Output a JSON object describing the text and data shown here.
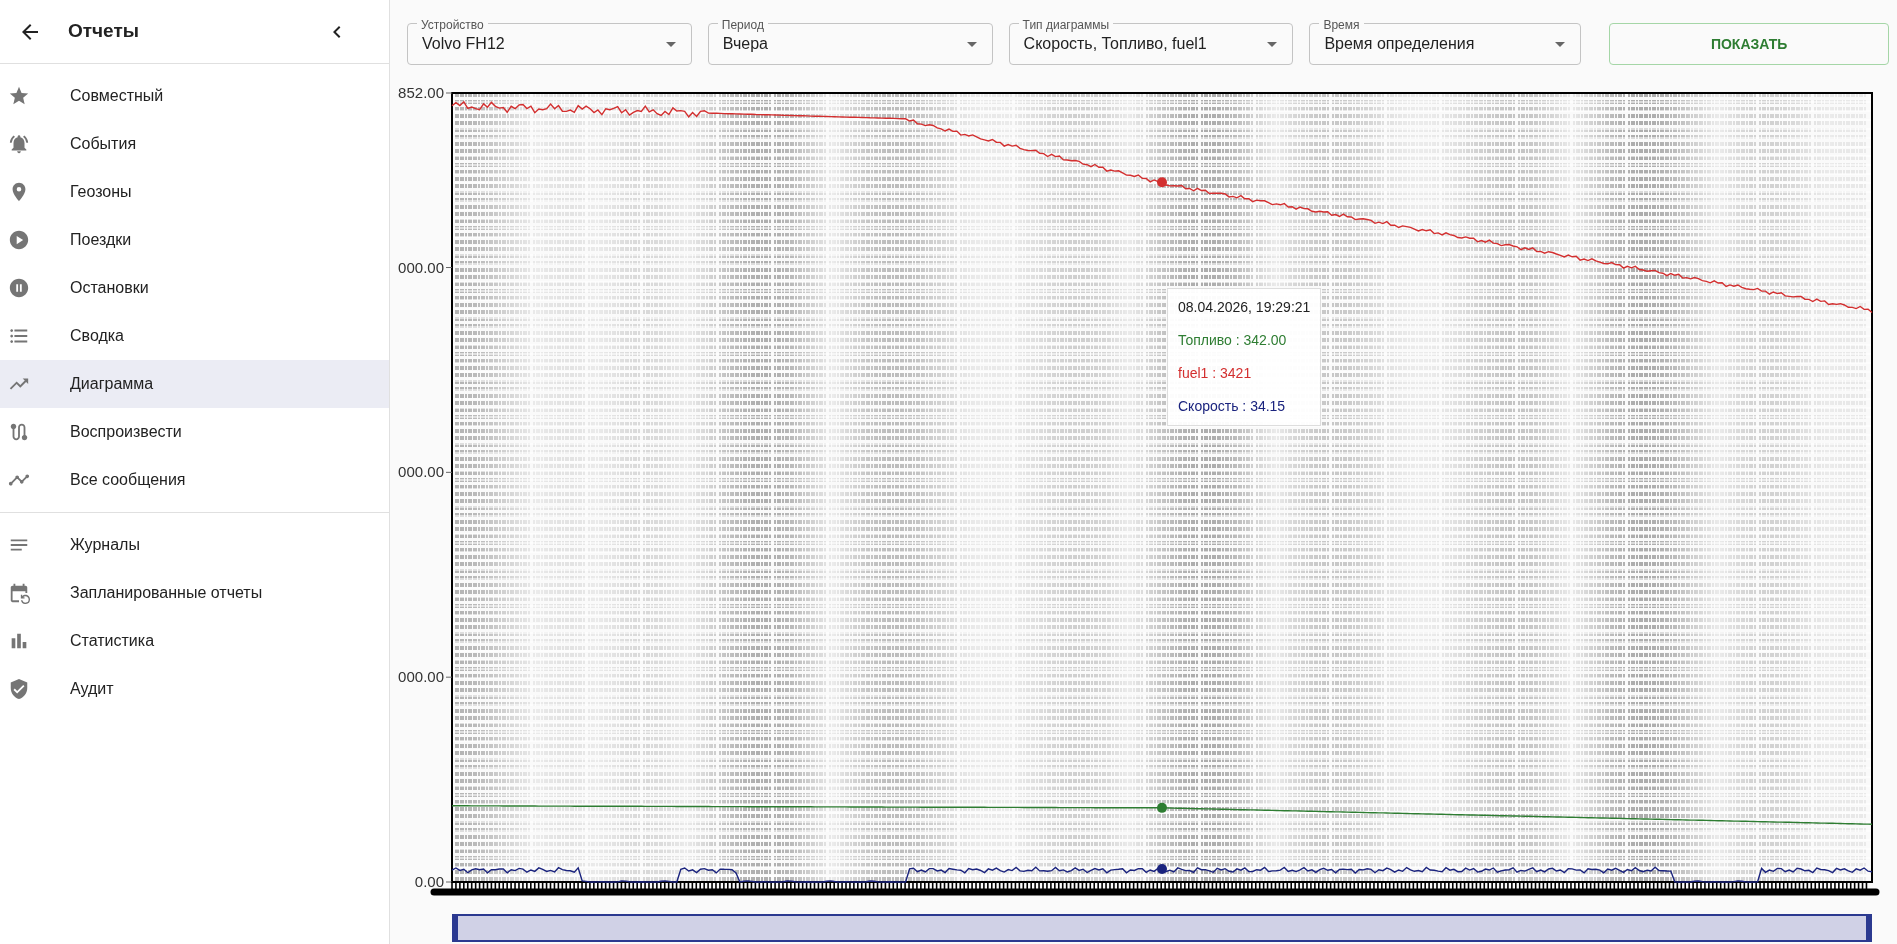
{
  "sidebar": {
    "title": "Отчеты",
    "groups": [
      [
        {
          "label": "Совместный",
          "selected": false
        },
        {
          "label": "События",
          "selected": false
        },
        {
          "label": "Геозоны",
          "selected": false
        },
        {
          "label": "Поездки",
          "selected": false
        },
        {
          "label": "Остановки",
          "selected": false
        },
        {
          "label": "Сводка",
          "selected": false
        },
        {
          "label": "Диаграмма",
          "selected": true
        },
        {
          "label": "Воспроизвести",
          "selected": false
        },
        {
          "label": "Все сообщения",
          "selected": false
        }
      ],
      [
        {
          "label": "Журналы",
          "selected": false
        },
        {
          "label": "Запланированные отчеты",
          "selected": false
        },
        {
          "label": "Статистика",
          "selected": false
        },
        {
          "label": "Аудит",
          "selected": false
        }
      ]
    ]
  },
  "filters": [
    {
      "label": "Устройство",
      "value": "Volvo FH12"
    },
    {
      "label": "Период",
      "value": "Вчера"
    },
    {
      "label": "Тип диаграммы",
      "value": "Скорость, Топливо, fuel1"
    },
    {
      "label": "Время",
      "value": "Время определения"
    }
  ],
  "show_button": "ПОКАЗАТЬ",
  "range_slider": {
    "level": 1
  },
  "chart": {
    "y_axis_labels": [
      "852.00",
      "000.00",
      "000.00",
      "000.00",
      "0.00"
    ],
    "series": [
      {
        "color": "#d32f2f"
      },
      {
        "color": "#2e7d32"
      },
      {
        "color": "#1a237e"
      }
    ],
    "tooltip": {
      "title": "08.04.2026, 19:29:21",
      "rows": [
        {
          "text": "Топливо : 342.00",
          "color": "#2e7d32"
        },
        {
          "text": "fuel1 : 3421",
          "color": "#d32f2f"
        },
        {
          "text": "Скорость : 34.15",
          "color": "#1a237e"
        }
      ]
    }
  }
}
